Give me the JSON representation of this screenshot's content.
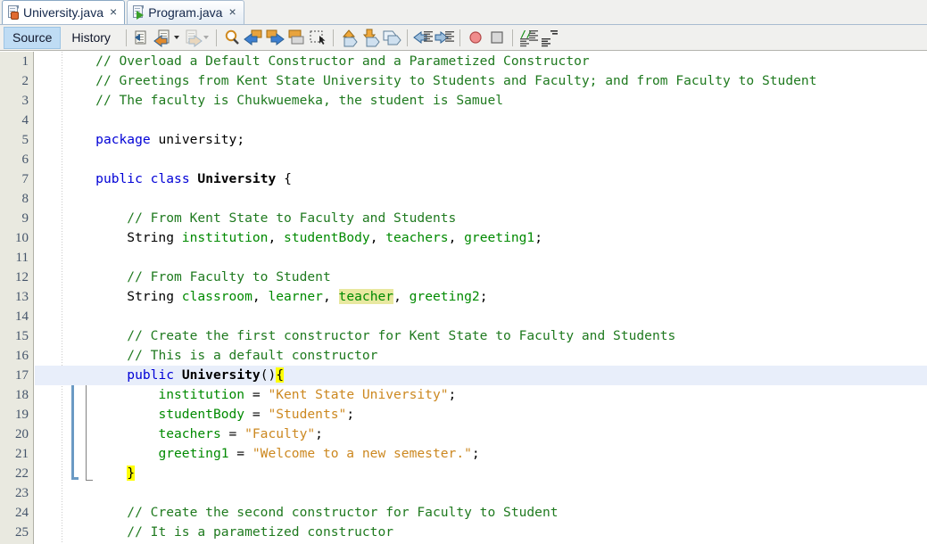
{
  "tabs": [
    {
      "label": "University.java",
      "icon": "java-file-icon",
      "active": true,
      "close_label": "×"
    },
    {
      "label": "Program.java",
      "icon": "java-main-file-icon",
      "active": false,
      "close_label": "×"
    }
  ],
  "toolbar": {
    "view_buttons": [
      {
        "label": "Source",
        "selected": true
      },
      {
        "label": "History",
        "selected": false
      }
    ],
    "icons": [
      "last-edit-icon",
      "back-history-icon",
      "forward-history-icon",
      "find-selection-icon",
      "previous-bookmark-icon",
      "next-bookmark-icon",
      "toggle-bookmark-icon",
      "toggle-rectangular-selection-icon",
      "previous-error-icon",
      "next-error-icon",
      "toggle-breakpoint-icon",
      "shift-left-icon",
      "shift-right-icon",
      "start-macro-recording-icon",
      "stop-macro-recording-icon",
      "comment-icon",
      "uncomment-icon"
    ]
  },
  "editor": {
    "current_line": 17,
    "change_bar_lines": [
      17,
      18,
      19,
      20,
      21,
      22
    ],
    "fold_start_line": 17,
    "fold_end_line": 22,
    "colors": {
      "comment": "#1f7a1f",
      "keyword": "#0000d6",
      "field": "#008a00",
      "string": "#cc8820",
      "plain": "#000000",
      "highlight": "#ffff00",
      "soft_highlight": "#e8e8a0",
      "current_line_bg": "#e8eefa",
      "gutter_bg": "#e9e9e0"
    },
    "lines": [
      {
        "n": 1,
        "tokens": [
          {
            "t": "    ",
            "c": "pln"
          },
          {
            "t": "// Overload a Default Constructor and a Parametized Constructor",
            "c": "cmt"
          }
        ]
      },
      {
        "n": 2,
        "tokens": [
          {
            "t": "    ",
            "c": "pln"
          },
          {
            "t": "// Greetings from Kent State University to Students and Faculty; and from Faculty to Student",
            "c": "cmt"
          }
        ]
      },
      {
        "n": 3,
        "tokens": [
          {
            "t": "    ",
            "c": "pln"
          },
          {
            "t": "// The faculty is Chukwuemeka, the student is Samuel",
            "c": "cmt"
          }
        ]
      },
      {
        "n": 4,
        "tokens": []
      },
      {
        "n": 5,
        "tokens": [
          {
            "t": "    ",
            "c": "pln"
          },
          {
            "t": "package",
            "c": "kw"
          },
          {
            "t": " university;",
            "c": "pln"
          }
        ]
      },
      {
        "n": 6,
        "tokens": []
      },
      {
        "n": 7,
        "tokens": [
          {
            "t": "    ",
            "c": "pln"
          },
          {
            "t": "public",
            "c": "kw"
          },
          {
            "t": " ",
            "c": "pln"
          },
          {
            "t": "class",
            "c": "kw"
          },
          {
            "t": " ",
            "c": "pln"
          },
          {
            "t": "University",
            "c": "typ"
          },
          {
            "t": " {",
            "c": "pln"
          }
        ]
      },
      {
        "n": 8,
        "tokens": []
      },
      {
        "n": 9,
        "tokens": [
          {
            "t": "        ",
            "c": "pln"
          },
          {
            "t": "// From Kent State to Faculty and Students",
            "c": "cmt"
          }
        ]
      },
      {
        "n": 10,
        "tokens": [
          {
            "t": "        String ",
            "c": "pln"
          },
          {
            "t": "institution",
            "c": "fld"
          },
          {
            "t": ", ",
            "c": "pln"
          },
          {
            "t": "studentBody",
            "c": "fld"
          },
          {
            "t": ", ",
            "c": "pln"
          },
          {
            "t": "teachers",
            "c": "fld"
          },
          {
            "t": ", ",
            "c": "pln"
          },
          {
            "t": "greeting1",
            "c": "fld"
          },
          {
            "t": ";",
            "c": "pln"
          }
        ]
      },
      {
        "n": 11,
        "tokens": []
      },
      {
        "n": 12,
        "tokens": [
          {
            "t": "        ",
            "c": "pln"
          },
          {
            "t": "// From Faculty to Student",
            "c": "cmt"
          }
        ]
      },
      {
        "n": 13,
        "tokens": [
          {
            "t": "        String ",
            "c": "pln"
          },
          {
            "t": "classroom",
            "c": "fld"
          },
          {
            "t": ", ",
            "c": "pln"
          },
          {
            "t": "learner",
            "c": "fld"
          },
          {
            "t": ", ",
            "c": "pln"
          },
          {
            "t": "teacher",
            "c": "fld hlsoft"
          },
          {
            "t": ", ",
            "c": "pln"
          },
          {
            "t": "greeting2",
            "c": "fld"
          },
          {
            "t": ";",
            "c": "pln"
          }
        ]
      },
      {
        "n": 14,
        "tokens": []
      },
      {
        "n": 15,
        "tokens": [
          {
            "t": "        ",
            "c": "pln"
          },
          {
            "t": "// Create the first constructor for Kent State to Faculty and Students",
            "c": "cmt"
          }
        ]
      },
      {
        "n": 16,
        "tokens": [
          {
            "t": "        ",
            "c": "pln"
          },
          {
            "t": "// This is a default constructor",
            "c": "cmt"
          }
        ]
      },
      {
        "n": 17,
        "tokens": [
          {
            "t": "        ",
            "c": "pln"
          },
          {
            "t": "public",
            "c": "kw"
          },
          {
            "t": " ",
            "c": "pln"
          },
          {
            "t": "University",
            "c": "typ"
          },
          {
            "t": "()",
            "c": "pln"
          },
          {
            "t": "{",
            "c": "pln hl"
          }
        ]
      },
      {
        "n": 18,
        "tokens": [
          {
            "t": "            ",
            "c": "pln"
          },
          {
            "t": "institution",
            "c": "fld"
          },
          {
            "t": " = ",
            "c": "pln"
          },
          {
            "t": "\"Kent State University\"",
            "c": "str"
          },
          {
            "t": ";",
            "c": "pln"
          }
        ]
      },
      {
        "n": 19,
        "tokens": [
          {
            "t": "            ",
            "c": "pln"
          },
          {
            "t": "studentBody",
            "c": "fld"
          },
          {
            "t": " = ",
            "c": "pln"
          },
          {
            "t": "\"Students\"",
            "c": "str"
          },
          {
            "t": ";",
            "c": "pln"
          }
        ]
      },
      {
        "n": 20,
        "tokens": [
          {
            "t": "            ",
            "c": "pln"
          },
          {
            "t": "teachers",
            "c": "fld"
          },
          {
            "t": " = ",
            "c": "pln"
          },
          {
            "t": "\"Faculty\"",
            "c": "str"
          },
          {
            "t": ";",
            "c": "pln"
          }
        ]
      },
      {
        "n": 21,
        "tokens": [
          {
            "t": "            ",
            "c": "pln"
          },
          {
            "t": "greeting1",
            "c": "fld"
          },
          {
            "t": " = ",
            "c": "pln"
          },
          {
            "t": "\"Welcome to a new semester.\"",
            "c": "str"
          },
          {
            "t": ";",
            "c": "pln"
          }
        ]
      },
      {
        "n": 22,
        "tokens": [
          {
            "t": "        ",
            "c": "pln"
          },
          {
            "t": "}",
            "c": "pln hl"
          }
        ]
      },
      {
        "n": 23,
        "tokens": []
      },
      {
        "n": 24,
        "tokens": [
          {
            "t": "        ",
            "c": "pln"
          },
          {
            "t": "// Create the second constructor for Faculty to Student",
            "c": "cmt"
          }
        ]
      },
      {
        "n": 25,
        "tokens": [
          {
            "t": "        ",
            "c": "pln"
          },
          {
            "t": "// It is a parametized constructor",
            "c": "cmt"
          }
        ]
      }
    ]
  }
}
